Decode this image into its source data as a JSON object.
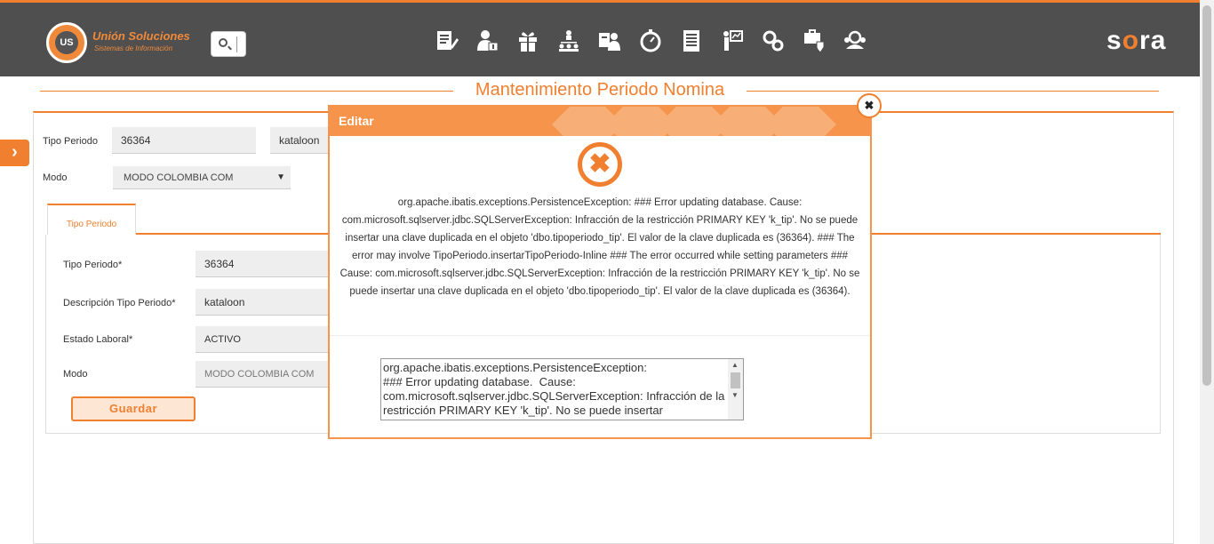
{
  "header": {
    "logo_mark": "US",
    "logo_name": "Unión Soluciones",
    "logo_sub": "Sistemas de Información",
    "brand_a": "s",
    "brand_dot": "o",
    "brand_b": "ra",
    "nav_icons": [
      "document-edit-icon",
      "user-money-icon",
      "gift-icon",
      "org-chart-icon",
      "user-card-icon",
      "stopwatch-icon",
      "report-list-icon",
      "presentation-icon",
      "gears-icon",
      "settings-shield-icon",
      "team-search-icon"
    ],
    "accent": "#f07f2f",
    "bg": "#4f4f4f"
  },
  "page": {
    "title": "Mantenimiento Periodo Nomina"
  },
  "filters": {
    "tipo_label": "Tipo Periodo",
    "tipo_code": "36364",
    "tipo_desc": "kataloon",
    "modo_label": "Modo",
    "modo_value": "MODO COLOMBIA COM"
  },
  "tab": {
    "label": "Tipo Periodo"
  },
  "form": {
    "tipo_label": "Tipo Periodo*",
    "tipo_value": "36364",
    "desc_label": "Descripción Tipo Periodo*",
    "desc_value": "kataloon",
    "estado_label": "Estado Laboral*",
    "estado_value": "ACTIVO",
    "modo_label": "Modo",
    "modo_value": "MODO COLOMBIA COM",
    "save_label": "Guardar"
  },
  "modal": {
    "title": "Editar",
    "close_glyph": "✖",
    "error_glyph": "✖",
    "message": "org.apache.ibatis.exceptions.PersistenceException: ### Error updating database. Cause: com.microsoft.sqlserver.jdbc.SQLServerException: Infracción de la restricción PRIMARY KEY 'k_tip'. No se puede insertar una clave duplicada en el objeto 'dbo.tipoperiodo_tip'. El valor de la clave duplicada es (36364). ### The error may involve TipoPeriodo.insertarTipoPeriodo-Inline ### The error occurred while setting parameters ### Cause: com.microsoft.sqlserver.jdbc.SQLServerException: Infracción de la restricción PRIMARY KEY 'k_tip'. No se puede insertar una clave duplicada en el objeto 'dbo.tipoperiodo_tip'. El valor de la clave duplicada es (36364).",
    "detail": "org.apache.ibatis.exceptions.PersistenceException: \n### Error updating database.  Cause: com.microsoft.sqlserver.jdbc.SQLServerException: Infracción de la restricción PRIMARY KEY 'k_tip'. No se puede insertar"
  }
}
